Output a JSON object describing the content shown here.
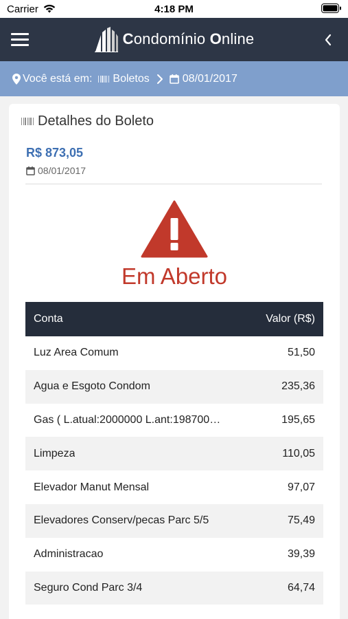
{
  "status_bar": {
    "carrier": "Carrier",
    "time": "4:18 PM"
  },
  "navbar": {
    "title_c": "C",
    "title_1": "ondomínio ",
    "title_o": "O",
    "title_2": "nline",
    "icons": [
      "menu-icon",
      "building-logo-icon",
      "chevron-left-icon"
    ]
  },
  "breadcrumb": {
    "prefix": "Você está em:",
    "section": "Boletos",
    "date": "08/01/2017"
  },
  "details": {
    "title": "Detalhes do Boleto",
    "amount": "R$ 873,05",
    "date": "08/01/2017",
    "status": "Em Aberto",
    "status_color": "#c1392b"
  },
  "table": {
    "header_conta": "Conta",
    "header_valor": "Valor (R$)",
    "rows": [
      {
        "conta": "Luz Area Comum",
        "valor": "51,50"
      },
      {
        "conta": "Agua e Esgoto Condom",
        "valor": "235,36"
      },
      {
        "conta": "Gas ( L.atual:2000000 L.ant:198700…",
        "valor": "195,65"
      },
      {
        "conta": "Limpeza",
        "valor": "110,05"
      },
      {
        "conta": "Elevador Manut Mensal",
        "valor": "97,07"
      },
      {
        "conta": "Elevadores Conserv/pecas Parc 5/5",
        "valor": "75,49"
      },
      {
        "conta": "Administracao",
        "valor": "39,39"
      },
      {
        "conta": "Seguro Cond Parc 3/4",
        "valor": "64,74"
      }
    ]
  },
  "colors": {
    "navbar": "#2d3646",
    "breadcrumb": "#7f9fcc",
    "amount": "#3d6fb2",
    "table_header": "#252d3b"
  }
}
